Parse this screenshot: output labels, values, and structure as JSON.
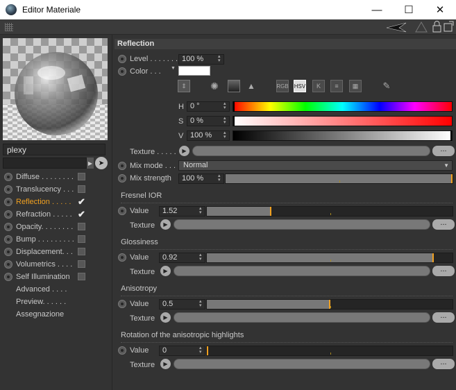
{
  "window": {
    "title": "Editor Materiale",
    "minimize": "—",
    "maximize": "☐",
    "close": "✕"
  },
  "material": {
    "name": "plexy"
  },
  "channels": [
    {
      "label": "Diffuse . . . . . . . .",
      "checked": false,
      "active": false
    },
    {
      "label": "Translucency . . .",
      "checked": false,
      "active": false
    },
    {
      "label": "Reflection . . . . .",
      "checked": true,
      "active": true
    },
    {
      "label": "Refraction . . . . .",
      "checked": true,
      "active": false
    },
    {
      "label": "Opacity. . . . . . . .",
      "checked": false,
      "active": false
    },
    {
      "label": "Bump . . . . . . . . .",
      "checked": false,
      "active": false
    },
    {
      "label": "Displacement. . .",
      "checked": false,
      "active": false
    },
    {
      "label": "Volumetrics . . . .",
      "checked": false,
      "active": false
    },
    {
      "label": "Self Illumination",
      "checked": false,
      "active": false
    }
  ],
  "extras": [
    "Advanced . . . .",
    "Preview. . . . . .",
    "Assegnazione"
  ],
  "reflection": {
    "header": "Reflection",
    "level_label": "Level . . . . . . .",
    "level_value": "100 %",
    "color_label": "Color . . .",
    "color_hex": "#ffffff",
    "color_modes": [
      "RGB",
      "HSV",
      "K"
    ],
    "h_label": "H",
    "h_value": "0 °",
    "s_label": "S",
    "s_value": "0 %",
    "v_label": "V",
    "v_value": "100 %",
    "texture_label": "Texture . . . . .",
    "mixmode_label": "Mix mode . . .",
    "mixmode_value": "Normal",
    "mixstrength_label": "Mix strength",
    "mixstrength_value": "100 %",
    "mixstrength_fraction": 1.0
  },
  "sections": [
    {
      "title": "Fresnel IOR",
      "value_label": "Value",
      "value": "1.52",
      "fraction": 0.26,
      "texture_label": "Texture"
    },
    {
      "title": "Glossiness",
      "value_label": "Value",
      "value": "0.92",
      "fraction": 0.92,
      "texture_label": "Texture"
    },
    {
      "title": "Anisotropy",
      "value_label": "Value",
      "value": "0.5",
      "fraction": 0.5,
      "texture_label": "Texture"
    },
    {
      "title": "Rotation of the anisotropic highlights",
      "value_label": "Value",
      "value": "0",
      "fraction": 0.0,
      "texture_label": "Texture"
    }
  ],
  "ellipsis": "...",
  "colors": {
    "accent": "#f0a020",
    "panel": "#333333"
  }
}
